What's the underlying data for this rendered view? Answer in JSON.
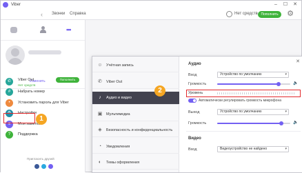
{
  "window": {
    "title": "Viber"
  },
  "menu": {
    "calls": "Звонки",
    "help": "Справка"
  },
  "header": {
    "credit_text": "Нет средств",
    "topup_label": "Пополнить"
  },
  "profile": {
    "edit_label": "Изменить"
  },
  "sidebar": {
    "items": [
      {
        "label": "Viber Out",
        "sub": "Нет средств",
        "action": "Пополнить",
        "icon": "phone-icon",
        "color": "#26a69a"
      },
      {
        "label": "Набрать номер",
        "icon": "dialpad-icon",
        "color": "#26a69a"
      },
      {
        "label": "Установить пароль для Viber",
        "icon": "lock-icon",
        "color": "#ef8a3e"
      },
      {
        "label": "Настройки",
        "icon": "gear-icon",
        "color": "#1f8fa8"
      },
      {
        "label": "Мои заметки",
        "icon": "notes-icon",
        "color": "#7360f2"
      },
      {
        "label": "Поддержка",
        "icon": "support-icon",
        "color": "#3fb33b"
      }
    ],
    "invite_text": "Пригласить друзей"
  },
  "badges": {
    "first": "1",
    "second": "2"
  },
  "settings": {
    "nav": [
      {
        "label": "Учётная запись",
        "icon": "account-icon"
      },
      {
        "label": "Viber Out",
        "icon": "phone-icon"
      },
      {
        "label": "Аудио и видео",
        "icon": "audio-icon",
        "active": true
      },
      {
        "label": "Мультимедиа",
        "icon": "media-icon"
      },
      {
        "label": "Безопасность и конфиденциальность",
        "icon": "shield-icon"
      },
      {
        "label": "Уведомления",
        "icon": "bell-icon"
      },
      {
        "label": "Темы оформления",
        "icon": "theme-icon"
      }
    ],
    "audio": {
      "title": "Аудио",
      "input_label": "Вход",
      "input_value": "Устройство по умолчанию",
      "volume_label": "Громкость",
      "input_volume": 0.84,
      "level_label": "Уровень",
      "auto_label": "Автоматически регулировать громкость микрофона",
      "auto_enabled": true,
      "output_label": "Выход",
      "output_value": "Устройство по умолчанию",
      "output_volume": 0.88
    },
    "video": {
      "title": "Видео",
      "input_label": "Вход",
      "input_value": "Видеоустройство не найдено"
    }
  },
  "colors": {
    "accent": "#7360f2",
    "green": "#3fb33b",
    "highlight": "#e2292b",
    "badge": "#f5a623"
  }
}
